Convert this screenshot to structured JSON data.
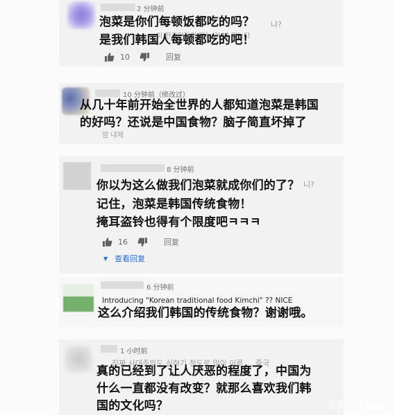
{
  "comments": [
    {
      "time": "2 分钟前",
      "lines": [
        "泡菜是你们每顿饭都吃的吗？",
        "是我们韩国人每顿都吃的吧！"
      ],
      "ghost": [
        "나?",
        "이 한국인들이 먹는 거 밥 먹는다"
      ],
      "likes": "10",
      "reply_label": "回复"
    },
    {
      "time": "10 分钟前（修改过）",
      "lines": [
        "从几十年前开始全世界的人都知道泡菜是韩国",
        "的好吗？还说是中国食物？脑子简直坏掉了"
      ],
      "ghost": [
        "암 내제"
      ]
    },
    {
      "time": "8 分钟前",
      "lines": [
        "你以为这么做我们泡菜就成你们的了？",
        "记住，泡菜是韩国传统食物！",
        "掩耳盗铃也得有个限度吧ㅋㅋㅋ"
      ],
      "ghost": [
        "니?"
      ],
      "likes": "16",
      "reply_label": "回复",
      "view_replies": "查看回复"
    },
    {
      "time": "6 分钟前",
      "english": "Introducing \"Korean traditional food Kimchi\" ?? NICE",
      "lines": [
        "这么介绍我们韩国的传统食物？谢谢哦。"
      ]
    },
    {
      "time": "1 小时前",
      "lines": [
        "真的已经到了让人厌恶的程度了，中国为",
        "什么一直都没有改变？就那么喜欢我们韩",
        "国的文化吗？"
      ],
      "ghost": [
        "... 진짜 사대주의도 심하기 정도로 많이 이루 ... 중국"
      ]
    }
  ],
  "watermark": "百家号/红樱娱乐",
  "colors": {
    "link": "#2a6dc9",
    "meta": "#707070",
    "card": "#f2f2f2"
  }
}
